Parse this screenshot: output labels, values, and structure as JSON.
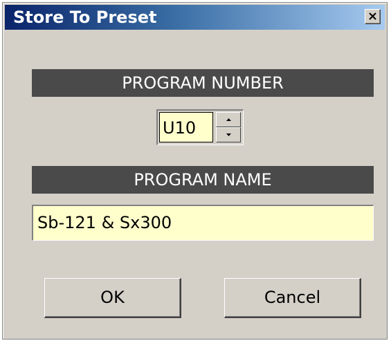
{
  "window": {
    "title": "Store To Preset",
    "close_icon": "close-icon"
  },
  "program_number": {
    "header": "PROGRAM NUMBER",
    "value": "U10",
    "spin_up_icon": "arrow-up-icon",
    "spin_down_icon": "arrow-down-icon"
  },
  "program_name": {
    "header": "PROGRAM NAME",
    "value": "Sb-121 & Sx300"
  },
  "buttons": {
    "ok_label": "OK",
    "cancel_label": "Cancel"
  },
  "colors": {
    "title_bar_start": "#0a246a",
    "title_bar_end": "#a6caf0",
    "dialog_bg": "#d4d0c8",
    "header_bg": "#4a4a4a",
    "field_bg": "#ffffcc"
  }
}
